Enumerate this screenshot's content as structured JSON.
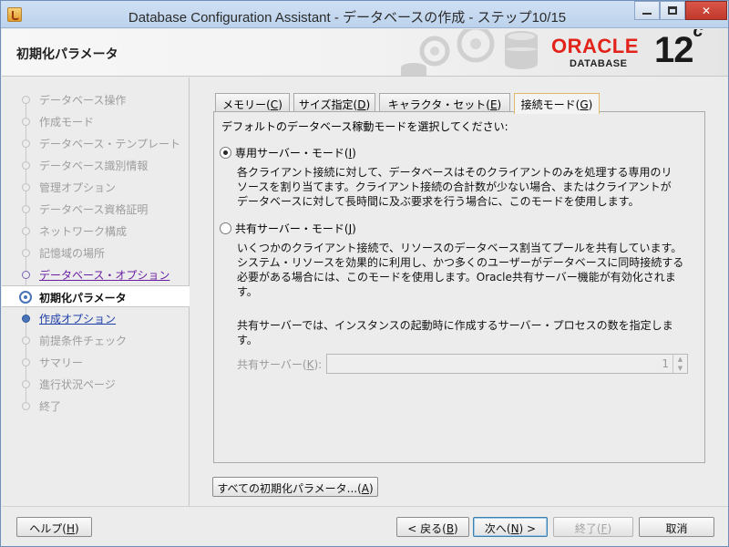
{
  "window": {
    "title": "Database Configuration Assistant - データベースの作成 - ステップ10/15"
  },
  "header": {
    "page_title": "初期化パラメータ",
    "brand": "ORACLE",
    "brand_sub": "DATABASE",
    "version": "12",
    "version_suffix": "c",
    "brand_color": "#e2231a"
  },
  "nav": {
    "items": [
      {
        "label": "データベース操作",
        "state": "disabled"
      },
      {
        "label": "作成モード",
        "state": "disabled"
      },
      {
        "label": "データベース・テンプレート",
        "state": "disabled"
      },
      {
        "label": "データベース識別情報",
        "state": "disabled"
      },
      {
        "label": "管理オプション",
        "state": "disabled"
      },
      {
        "label": "データベース資格証明",
        "state": "disabled"
      },
      {
        "label": "ネットワーク構成",
        "state": "disabled"
      },
      {
        "label": "記憶域の場所",
        "state": "disabled"
      },
      {
        "label": "データベース・オプション",
        "state": "visited"
      },
      {
        "label": "初期化パラメータ",
        "state": "current"
      },
      {
        "label": "作成オプション",
        "state": "link"
      },
      {
        "label": "前提条件チェック",
        "state": "disabled"
      },
      {
        "label": "サマリー",
        "state": "disabled"
      },
      {
        "label": "進行状況ページ",
        "state": "disabled"
      },
      {
        "label": "終了",
        "state": "disabled"
      }
    ]
  },
  "tabs": [
    {
      "label": "メモリー(",
      "mnemonic": "C",
      "close": ")",
      "active": false
    },
    {
      "label": "サイズ指定(",
      "mnemonic": "D",
      "close": ")",
      "active": false
    },
    {
      "label": "キャラクタ・セット(",
      "mnemonic": "E",
      "close": ")",
      "active": false
    },
    {
      "label": "接続モード(",
      "mnemonic": "G",
      "close": ")",
      "active": true
    }
  ],
  "panel": {
    "intro": "デフォルトのデータベース稼動モードを選択してください:",
    "dedicated": {
      "label": "専用サーバー・モード(",
      "mnemonic": "I",
      "close": ")",
      "checked": true,
      "desc_lines": [
        "各クライアント接続に対して、データベースはそのクライアントのみを処理する専用のリ",
        "ソースを割り当てます。クライアント接続の合計数が少ない場合、またはクライアントが",
        "データベースに対して長時間に及ぶ要求を行う場合に、このモードを使用します。"
      ]
    },
    "shared": {
      "label": "共有サーバー・モード(",
      "mnemonic": "J",
      "close": ")",
      "checked": false,
      "desc_lines": [
        "いくつかのクライアント接続で、リソースのデータベース割当てプールを共有しています。",
        "システム・リソースを効果的に利用し、かつ多くのユーザーがデータベースに同時接続する",
        "必要がある場合には、このモードを使用します。Oracle共有サーバー機能が有効化されま",
        "す。"
      ],
      "note_lines": [
        "共有サーバーでは、インスタンスの起動時に作成するサーバー・プロセスの数を指定しま",
        "す。"
      ],
      "field_label": "共有サーバー(",
      "field_mnemonic": "K",
      "field_close": "):",
      "field_value": "1"
    }
  },
  "buttons": {
    "all_params": {
      "label": "すべての初期化パラメータ...(",
      "mnemonic": "A",
      "close": ")"
    },
    "help": {
      "label": "ヘルプ(",
      "mnemonic": "H",
      "close": ")"
    },
    "back": {
      "label": "< 戻る(",
      "mnemonic": "B",
      "close": ")"
    },
    "next": {
      "label": "次へ(",
      "mnemonic": "N",
      "close": ") >"
    },
    "finish": {
      "label": "終了(",
      "mnemonic": "F",
      "close": ")"
    },
    "cancel": {
      "label": "取消"
    }
  }
}
